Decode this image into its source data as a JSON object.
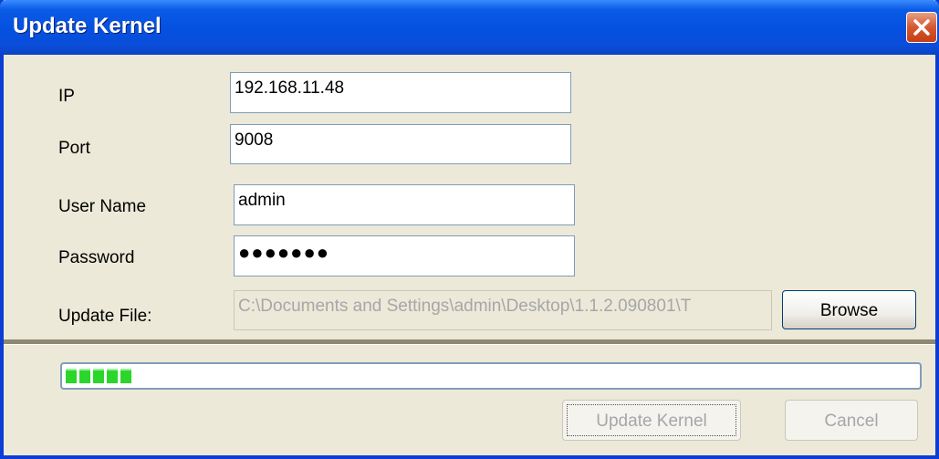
{
  "window": {
    "title": "Update Kernel"
  },
  "form": {
    "ip_label": "IP",
    "ip_value": "192.168.11.48",
    "port_label": "Port",
    "port_value": "9008",
    "username_label": "User Name",
    "username_value": "admin",
    "password_label": "Password",
    "password_mask": "●●●●●●●",
    "file_label": "Update File:",
    "file_value": "C:\\Documents and Settings\\admin\\Desktop\\1.1.2.090801\\T",
    "browse_label": "Browse"
  },
  "progress": {
    "segments": 5,
    "color": "#2BD62B"
  },
  "buttons": {
    "update_label": "Update Kernel",
    "cancel_label": "Cancel"
  },
  "icons": {
    "close": "close-icon"
  }
}
